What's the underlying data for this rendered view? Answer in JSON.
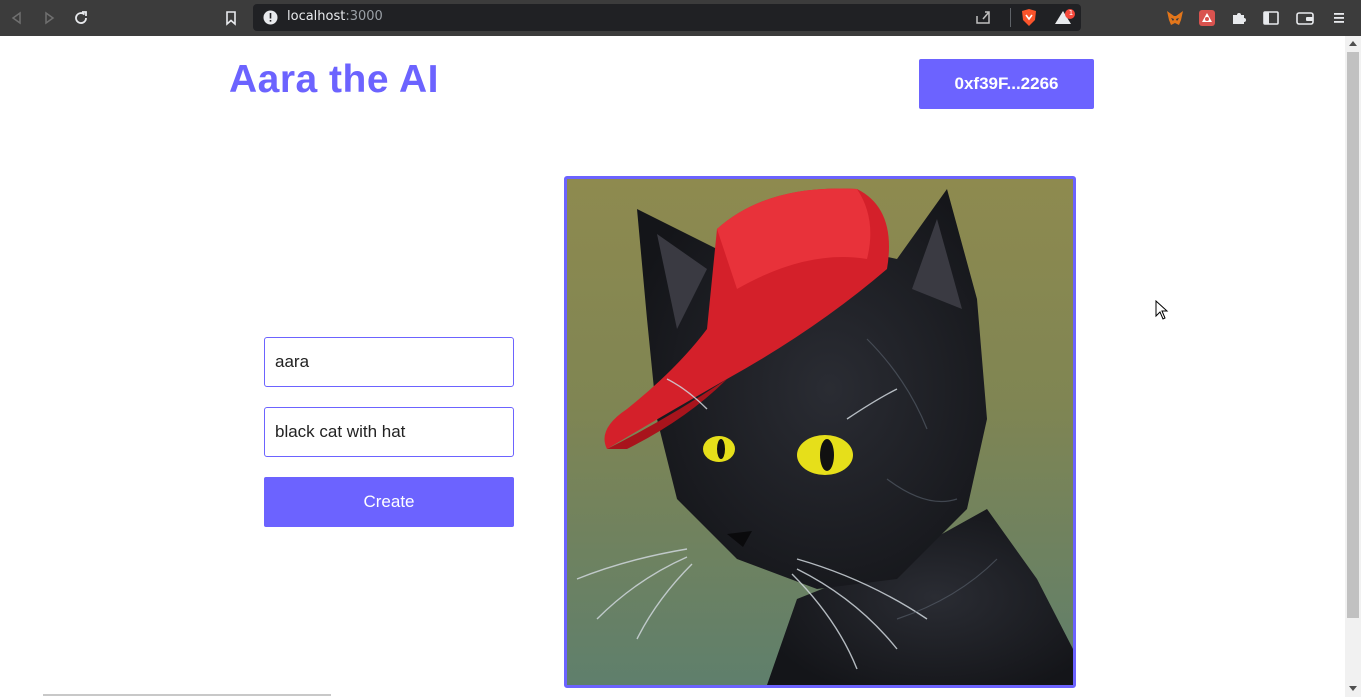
{
  "browser": {
    "url_host": "localhost",
    "url_port": ":3000",
    "notification_count": "1",
    "icons": {
      "back": "back-arrow-icon",
      "forward": "forward-arrow-icon",
      "reload": "reload-icon",
      "bookmark": "bookmark-icon",
      "site_info": "site-info-icon",
      "share": "share-icon",
      "brave_shields": "brave-shields-icon",
      "brave_rewards": "brave-rewards-icon",
      "metamask": "metamask-fox-icon",
      "extension": "extension-icon",
      "extensions_menu": "puzzle-icon",
      "sidebar": "sidebar-icon",
      "wallet": "wallet-icon",
      "menu": "hamburger-menu-icon"
    }
  },
  "header": {
    "title": "Aara the AI",
    "wallet_address": "0xf39F...2266"
  },
  "form": {
    "name_value": "aara",
    "prompt_value": "black cat with hat",
    "create_label": "Create"
  },
  "image": {
    "description_icon": "generated-image"
  },
  "colors": {
    "accent": "#6c63ff",
    "chrome_bg": "#3c3c3c",
    "address_bg": "#202124"
  }
}
